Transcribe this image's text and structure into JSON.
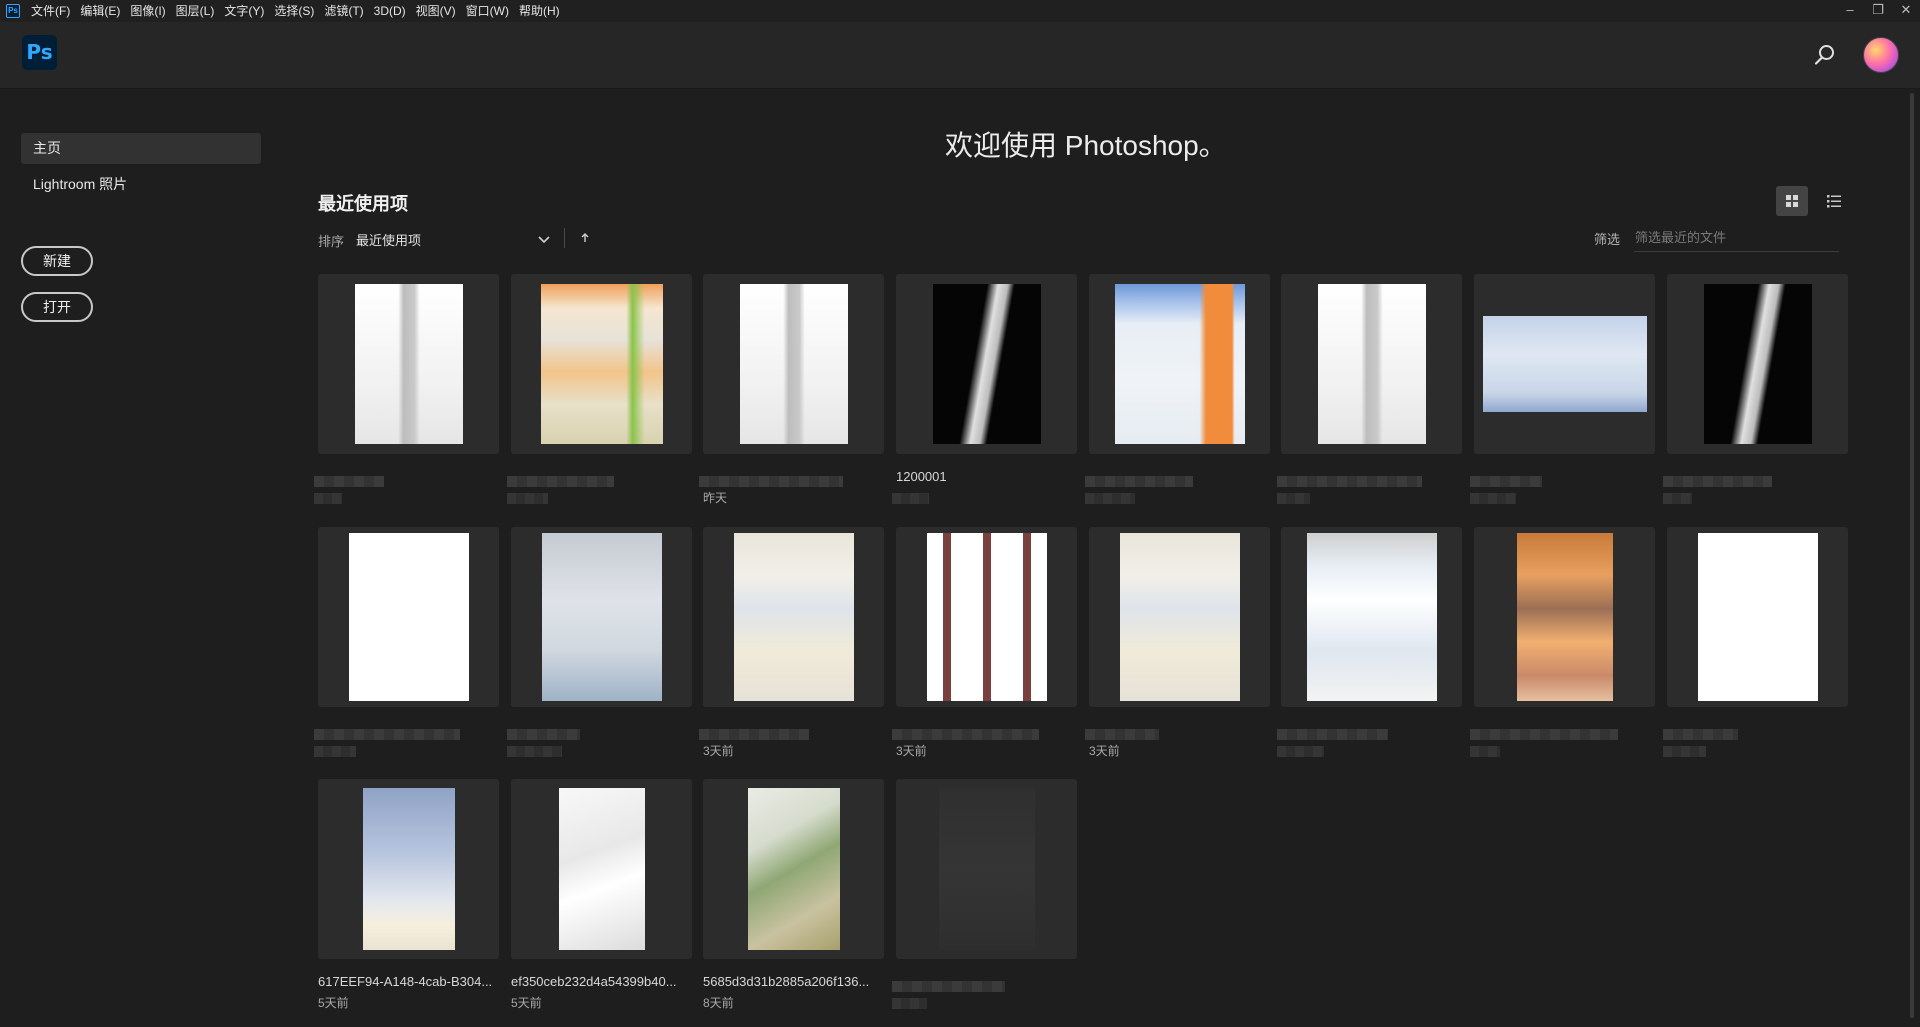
{
  "app": {
    "logo_text": "Ps",
    "menu": [
      "文件(F)",
      "编辑(E)",
      "图像(I)",
      "图层(L)",
      "文字(Y)",
      "选择(S)",
      "滤镜(T)",
      "3D(D)",
      "视图(V)",
      "窗口(W)",
      "帮助(H)"
    ],
    "window_controls": [
      "–",
      "❐",
      "✕"
    ]
  },
  "sidebar": {
    "items": [
      {
        "label": "主页",
        "active": true
      },
      {
        "label": "Lightroom 照片",
        "active": false
      }
    ],
    "new_label": "新建",
    "open_label": "打开"
  },
  "main": {
    "welcome": "欢迎使用 Photoshop。",
    "recent_title": "最近使用项",
    "sort_label": "排序",
    "sort_value": "最近使用项",
    "filter_label": "筛选",
    "filter_placeholder": "筛选最近的文件"
  },
  "files": [
    {
      "name": "",
      "date": "",
      "thumb": "white-tall"
    },
    {
      "name": "",
      "date": "",
      "thumb": "orange-menu"
    },
    {
      "name": "",
      "date": "昨天",
      "thumb": "white-tall"
    },
    {
      "name": "1200001",
      "date": "",
      "thumb": "black-figure"
    },
    {
      "name": "",
      "date": "",
      "thumb": "blue-ui"
    },
    {
      "name": "",
      "date": "",
      "thumb": "white-tall"
    },
    {
      "name": "",
      "date": "",
      "thumb": "blue-wide"
    },
    {
      "name": "",
      "date": "",
      "thumb": "black-figure"
    },
    {
      "name": "",
      "date": "",
      "thumb": "white-blank"
    },
    {
      "name": "",
      "date": "",
      "thumb": "grey-blue"
    },
    {
      "name": "",
      "date": "3天前",
      "thumb": "light-doc"
    },
    {
      "name": "",
      "date": "3天前",
      "thumb": "pattern-red"
    },
    {
      "name": "",
      "date": "3天前",
      "thumb": "light-doc"
    },
    {
      "name": "",
      "date": "",
      "thumb": "blue-ui-2"
    },
    {
      "name": "",
      "date": "",
      "thumb": "orange-portrait"
    },
    {
      "name": "",
      "date": "",
      "thumb": "white-blank"
    },
    {
      "name": "617EEF94-A148-4cab-B304...",
      "date": "5天前",
      "thumb": "sky-clouds"
    },
    {
      "name": "ef350ceb232d4a54399b40...",
      "date": "5天前",
      "thumb": "white-fabric"
    },
    {
      "name": "5685d3d31b2885a206f136...",
      "date": "8天前",
      "thumb": "green-splash"
    },
    {
      "name": "",
      "date": "",
      "thumb": "dark-phone"
    }
  ],
  "icons": {
    "search": "search-icon",
    "grid_view": "grid-view-icon",
    "list_view": "list-view-icon",
    "sort_chevron": "chevron-down-icon",
    "sort_direction": "arrow-up-icon"
  }
}
